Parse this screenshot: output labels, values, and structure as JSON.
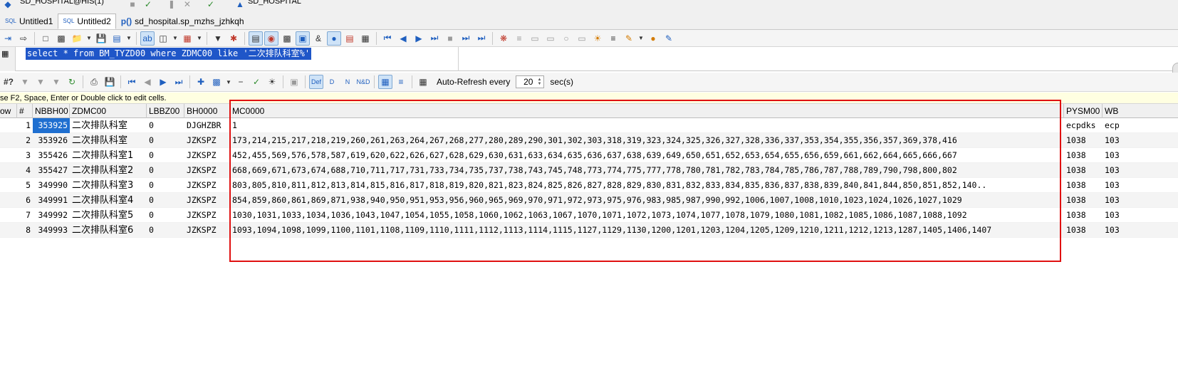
{
  "top_strip": {
    "connection": "SD_HOSPITAL@HIS(1)",
    "user": "SD_HOSPITAL"
  },
  "tabs": [
    {
      "icon_label": "SQL",
      "label": "Untitled1",
      "active": false
    },
    {
      "icon_label": "SQL",
      "label": "Untitled2",
      "active": true
    },
    {
      "icon_label": "p()",
      "label": "sd_hospital.sp_mzhs_jzhkqh",
      "active": false
    }
  ],
  "sql": {
    "text": "select * from BM_TYZD00 where ZDMC00 like '二次排队科室%'"
  },
  "grid_toolbar": {
    "autorefresh_label": "Auto-Refresh every",
    "interval": "20",
    "unit": "sec(s)"
  },
  "hint": "se F2, Space, Enter or Double click to edit cells.",
  "grid": {
    "columns": [
      "ow",
      "#",
      "NBBH00",
      "ZDMC00",
      "LBBZ00",
      "BH0000",
      "MC0000",
      "PYSM00",
      "WB"
    ],
    "rows": [
      {
        "n": "1",
        "nbbh": "353925",
        "zdmc": "二次排队科室",
        "lbbz": "0",
        "bh": "DJGHZBR",
        "mc": "1",
        "pysm": "ecpdks",
        "wb": "ecp"
      },
      {
        "n": "2",
        "nbbh": "353926",
        "zdmc": "二次排队科室",
        "lbbz": "0",
        "bh": "JZKSPZ",
        "mc": "173,214,215,217,218,219,260,261,263,264,267,268,277,280,289,290,301,302,303,318,319,323,324,325,326,327,328,336,337,353,354,355,356,357,369,378,416",
        "pysm": "1038",
        "wb": "103"
      },
      {
        "n": "3",
        "nbbh": "355426",
        "zdmc": "二次排队科室1",
        "lbbz": "0",
        "bh": "JZKSPZ",
        "mc": "452,455,569,576,578,587,619,620,622,626,627,628,629,630,631,633,634,635,636,637,638,639,649,650,651,652,653,654,655,656,659,661,662,664,665,666,667",
        "pysm": "1038",
        "wb": "103"
      },
      {
        "n": "4",
        "nbbh": "355427",
        "zdmc": "二次排队科室2",
        "lbbz": "0",
        "bh": "JZKSPZ",
        "mc": "668,669,671,673,674,688,710,711,717,731,733,734,735,737,738,743,745,748,773,774,775,777,778,780,781,782,783,784,785,786,787,788,789,790,798,800,802",
        "pysm": "1038",
        "wb": "103"
      },
      {
        "n": "5",
        "nbbh": "349990",
        "zdmc": "二次排队科室3",
        "lbbz": "0",
        "bh": "JZKSPZ",
        "mc": "803,805,810,811,812,813,814,815,816,817,818,819,820,821,823,824,825,826,827,828,829,830,831,832,833,834,835,836,837,838,839,840,841,844,850,851,852,140..",
        "pysm": "1038",
        "wb": "103"
      },
      {
        "n": "6",
        "nbbh": "349991",
        "zdmc": "二次排队科室4",
        "lbbz": "0",
        "bh": "JZKSPZ",
        "mc": "854,859,860,861,869,871,938,940,950,951,953,956,960,965,969,970,971,972,973,975,976,983,985,987,990,992,1006,1007,1008,1010,1023,1024,1026,1027,1029",
        "pysm": "1038",
        "wb": "103"
      },
      {
        "n": "7",
        "nbbh": "349992",
        "zdmc": "二次排队科室5",
        "lbbz": "0",
        "bh": "JZKSPZ",
        "mc": "1030,1031,1033,1034,1036,1043,1047,1054,1055,1058,1060,1062,1063,1067,1070,1071,1072,1073,1074,1077,1078,1079,1080,1081,1082,1085,1086,1087,1088,1092",
        "pysm": "1038",
        "wb": "103"
      },
      {
        "n": "8",
        "nbbh": "349993",
        "zdmc": "二次排队科室6",
        "lbbz": "0",
        "bh": "JZKSPZ",
        "mc": "1093,1094,1098,1099,1100,1101,1108,1109,1110,1111,1112,1113,1114,1115,1127,1129,1130,1200,1201,1203,1204,1205,1209,1210,1211,1212,1213,1287,1405,1406,1407",
        "pysm": "1038",
        "wb": "103"
      }
    ]
  },
  "icons": {
    "grid_toolbar_labels": {
      "def": "Def",
      "d": "D",
      "n": "N",
      "nd": "N&D",
      "hash": "#?",
      "and": "&"
    }
  }
}
